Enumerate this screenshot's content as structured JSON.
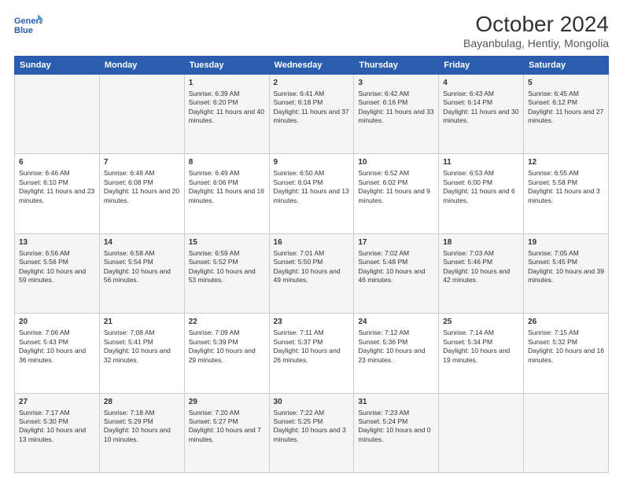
{
  "logo": {
    "line1": "General",
    "line2": "Blue"
  },
  "title": "October 2024",
  "subtitle": "Bayanbulag, Hentiy, Mongolia",
  "headers": [
    "Sunday",
    "Monday",
    "Tuesday",
    "Wednesday",
    "Thursday",
    "Friday",
    "Saturday"
  ],
  "weeks": [
    [
      {
        "day": "",
        "content": ""
      },
      {
        "day": "",
        "content": ""
      },
      {
        "day": "1",
        "content": "Sunrise: 6:39 AM\nSunset: 6:20 PM\nDaylight: 11 hours and 40 minutes."
      },
      {
        "day": "2",
        "content": "Sunrise: 6:41 AM\nSunset: 6:18 PM\nDaylight: 11 hours and 37 minutes."
      },
      {
        "day": "3",
        "content": "Sunrise: 6:42 AM\nSunset: 6:16 PM\nDaylight: 11 hours and 33 minutes."
      },
      {
        "day": "4",
        "content": "Sunrise: 6:43 AM\nSunset: 6:14 PM\nDaylight: 11 hours and 30 minutes."
      },
      {
        "day": "5",
        "content": "Sunrise: 6:45 AM\nSunset: 6:12 PM\nDaylight: 11 hours and 27 minutes."
      }
    ],
    [
      {
        "day": "6",
        "content": "Sunrise: 6:46 AM\nSunset: 6:10 PM\nDaylight: 11 hours and 23 minutes."
      },
      {
        "day": "7",
        "content": "Sunrise: 6:48 AM\nSunset: 6:08 PM\nDaylight: 11 hours and 20 minutes."
      },
      {
        "day": "8",
        "content": "Sunrise: 6:49 AM\nSunset: 6:06 PM\nDaylight: 11 hours and 16 minutes."
      },
      {
        "day": "9",
        "content": "Sunrise: 6:50 AM\nSunset: 6:04 PM\nDaylight: 11 hours and 13 minutes."
      },
      {
        "day": "10",
        "content": "Sunrise: 6:52 AM\nSunset: 6:02 PM\nDaylight: 11 hours and 9 minutes."
      },
      {
        "day": "11",
        "content": "Sunrise: 6:53 AM\nSunset: 6:00 PM\nDaylight: 11 hours and 6 minutes."
      },
      {
        "day": "12",
        "content": "Sunrise: 6:55 AM\nSunset: 5:58 PM\nDaylight: 11 hours and 3 minutes."
      }
    ],
    [
      {
        "day": "13",
        "content": "Sunrise: 6:56 AM\nSunset: 5:56 PM\nDaylight: 10 hours and 59 minutes."
      },
      {
        "day": "14",
        "content": "Sunrise: 6:58 AM\nSunset: 5:54 PM\nDaylight: 10 hours and 56 minutes."
      },
      {
        "day": "15",
        "content": "Sunrise: 6:59 AM\nSunset: 5:52 PM\nDaylight: 10 hours and 53 minutes."
      },
      {
        "day": "16",
        "content": "Sunrise: 7:01 AM\nSunset: 5:50 PM\nDaylight: 10 hours and 49 minutes."
      },
      {
        "day": "17",
        "content": "Sunrise: 7:02 AM\nSunset: 5:48 PM\nDaylight: 10 hours and 46 minutes."
      },
      {
        "day": "18",
        "content": "Sunrise: 7:03 AM\nSunset: 5:46 PM\nDaylight: 10 hours and 42 minutes."
      },
      {
        "day": "19",
        "content": "Sunrise: 7:05 AM\nSunset: 5:45 PM\nDaylight: 10 hours and 39 minutes."
      }
    ],
    [
      {
        "day": "20",
        "content": "Sunrise: 7:06 AM\nSunset: 5:43 PM\nDaylight: 10 hours and 36 minutes."
      },
      {
        "day": "21",
        "content": "Sunrise: 7:08 AM\nSunset: 5:41 PM\nDaylight: 10 hours and 32 minutes."
      },
      {
        "day": "22",
        "content": "Sunrise: 7:09 AM\nSunset: 5:39 PM\nDaylight: 10 hours and 29 minutes."
      },
      {
        "day": "23",
        "content": "Sunrise: 7:11 AM\nSunset: 5:37 PM\nDaylight: 10 hours and 26 minutes."
      },
      {
        "day": "24",
        "content": "Sunrise: 7:12 AM\nSunset: 5:36 PM\nDaylight: 10 hours and 23 minutes."
      },
      {
        "day": "25",
        "content": "Sunrise: 7:14 AM\nSunset: 5:34 PM\nDaylight: 10 hours and 19 minutes."
      },
      {
        "day": "26",
        "content": "Sunrise: 7:15 AM\nSunset: 5:32 PM\nDaylight: 10 hours and 16 minutes."
      }
    ],
    [
      {
        "day": "27",
        "content": "Sunrise: 7:17 AM\nSunset: 5:30 PM\nDaylight: 10 hours and 13 minutes."
      },
      {
        "day": "28",
        "content": "Sunrise: 7:18 AM\nSunset: 5:29 PM\nDaylight: 10 hours and 10 minutes."
      },
      {
        "day": "29",
        "content": "Sunrise: 7:20 AM\nSunset: 5:27 PM\nDaylight: 10 hours and 7 minutes."
      },
      {
        "day": "30",
        "content": "Sunrise: 7:22 AM\nSunset: 5:25 PM\nDaylight: 10 hours and 3 minutes."
      },
      {
        "day": "31",
        "content": "Sunrise: 7:23 AM\nSunset: 5:24 PM\nDaylight: 10 hours and 0 minutes."
      },
      {
        "day": "",
        "content": ""
      },
      {
        "day": "",
        "content": ""
      }
    ]
  ]
}
